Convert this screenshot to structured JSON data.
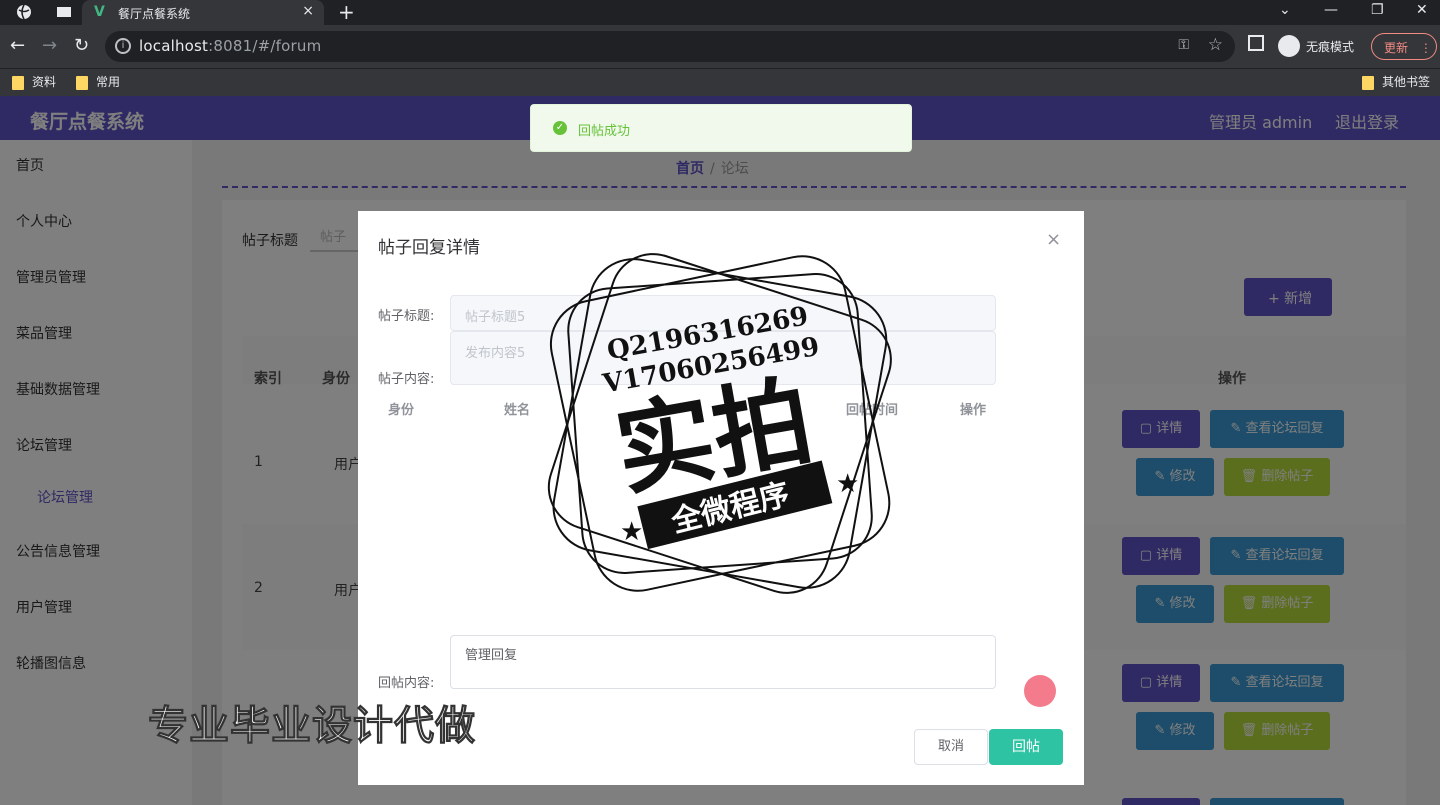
{
  "browser": {
    "tab_title": "餐厅点餐系统",
    "new_tab": "+",
    "url_host": "localhost",
    "url_rest": ":8081/#/forum",
    "incognito_label": "无痕模式",
    "update_label": "更新",
    "bookmarks": [
      "资料",
      "常用"
    ],
    "other_bookmarks": "其他书签"
  },
  "app": {
    "brand": "餐厅点餐系统",
    "user": "管理员 admin",
    "logout": "退出登录"
  },
  "sidebar": {
    "items": [
      "首页",
      "个人中心",
      "管理员管理",
      "菜品管理",
      "基础数据管理",
      "论坛管理",
      "论坛管理",
      "公告信息管理",
      "用户管理",
      "轮播图信息"
    ]
  },
  "breadcrumb": {
    "home": "首页",
    "current": "论坛"
  },
  "filters": {
    "title_label": "帖子标题",
    "title_input": "帖子"
  },
  "toolbar": {
    "add": "+ 新增"
  },
  "table": {
    "headers": {
      "index": "索引",
      "identity": "身份",
      "ops": "操作"
    },
    "rows": [
      {
        "index": "1",
        "identity": "用户"
      },
      {
        "index": "2",
        "identity": "用户"
      }
    ],
    "buttons": {
      "detail": "详情",
      "view": "查看论坛回复",
      "edit": "修改",
      "delete": "删除帖子"
    }
  },
  "toast": {
    "message": "回帖成功"
  },
  "dialog": {
    "title": "帖子回复详情",
    "close": "×",
    "title_label": "帖子标题:",
    "title_value": "帖子标题5",
    "content_label": "帖子内容:",
    "content_value": "发布内容5",
    "columns": [
      "身份",
      "姓名",
      "回帖时间",
      "操作"
    ],
    "reply_label": "回帖内容:",
    "reply_value": "管理回复",
    "cancel": "取消",
    "submit": "回帖"
  },
  "watermark": {
    "qq": "Q2196316269",
    "wx": "V17060256499",
    "big": "实拍",
    "ribbon": "全微程序",
    "footer": "专业毕业设计代做"
  }
}
